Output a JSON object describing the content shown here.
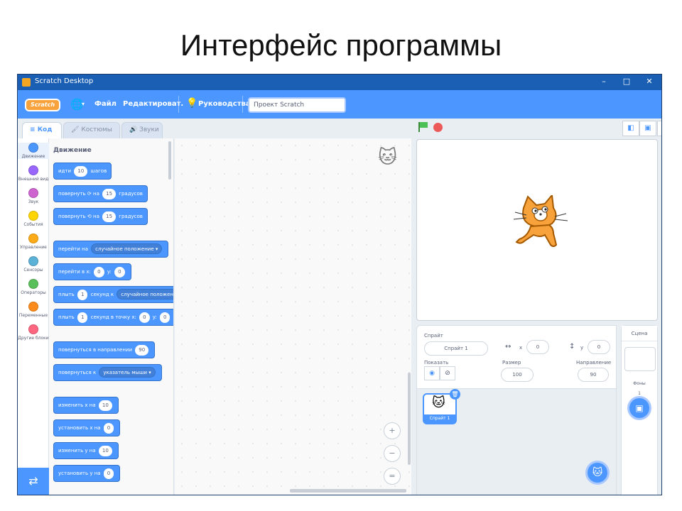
{
  "slide": {
    "title": "Интерфейс программы"
  },
  "window": {
    "title": "Scratch Desktop",
    "minimize": "–",
    "maximize": "□",
    "close": "✕"
  },
  "menubar": {
    "logo": "Scratch",
    "file": "Файл",
    "edit": "Редактироват.",
    "tutorials": "Руководства",
    "project_title": "Проект Scratch"
  },
  "tabs": {
    "code": "Код",
    "costumes": "Костюмы",
    "sounds": "Звуки"
  },
  "categories": [
    {
      "label": "Движение",
      "color": "#4c97ff"
    },
    {
      "label": "Внешний вид",
      "color": "#9966ff"
    },
    {
      "label": "Звук",
      "color": "#cf63cf"
    },
    {
      "label": "События",
      "color": "#ffd500"
    },
    {
      "label": "Управление",
      "color": "#ffab19"
    },
    {
      "label": "Сенсоры",
      "color": "#5cb1d6"
    },
    {
      "label": "Операторы",
      "color": "#59c059"
    },
    {
      "label": "Переменные",
      "color": "#ff8c1a"
    },
    {
      "label": "Другие блоки",
      "color": "#ff6680"
    }
  ],
  "palette": {
    "heading": "Движение",
    "move": {
      "a": "идти",
      "n": "10",
      "b": "шагов"
    },
    "turn_right": {
      "a": "повернуть",
      "b": "на",
      "n": "15",
      "c": "градусов"
    },
    "turn_left": {
      "a": "повернуть",
      "b": "на",
      "n": "15",
      "c": "градусов"
    },
    "goto": {
      "a": "перейти на",
      "dd": "случайное положение"
    },
    "goto_xy": {
      "a": "перейти в x:",
      "x": "0",
      "b": "y:",
      "y": "0"
    },
    "glide": {
      "a": "плыть",
      "n": "1",
      "b": "секунд к",
      "dd": "случайное положение"
    },
    "glide_xy": {
      "a": "плыть",
      "n": "1",
      "b": "секунд в точку x:",
      "x": "0",
      "c": "y:",
      "y": "0"
    },
    "point_dir": {
      "a": "повернуться в направлении",
      "n": "90"
    },
    "point_towards": {
      "a": "повернуться к",
      "dd": "указатель мыши"
    },
    "change_x": {
      "a": "изменить x на",
      "n": "10"
    },
    "set_x": {
      "a": "установить x на",
      "n": "0"
    },
    "change_y": {
      "a": "изменить y на",
      "n": "10"
    },
    "set_y": {
      "a": "установить y на",
      "n": "0"
    }
  },
  "sprite_info": {
    "sprite_label": "Спрайт",
    "sprite_name": "Спрайт 1",
    "x_label": "x",
    "x_value": "0",
    "y_label": "y",
    "y_value": "0",
    "show_label": "Показать",
    "size_label": "Размер",
    "size_value": "100",
    "direction_label": "Направление",
    "direction_value": "90"
  },
  "sprite_list": {
    "thumb_name": "Спрайт 1"
  },
  "stage_pane": {
    "title": "Сцена",
    "backdrops_label": "Фоны",
    "backdrops_count": "1"
  },
  "icons": {
    "globe": "🌐",
    "caret": "▾",
    "bulb": "💡",
    "code_tab": "≡",
    "brush": "🖌",
    "speaker": "🔊",
    "zoom_in": "+",
    "zoom_out": "−",
    "zoom_reset": "=",
    "extension": "⇄",
    "view_small": "◧",
    "view_normal": "▣",
    "fullscreen": "⤢",
    "delete": "🗑",
    "show": "◉",
    "hide": "⊘",
    "horizontal_arrows": "↔",
    "vertical_arrows": "↕",
    "sprite_cat": "🐱",
    "choose_sprite": "🐱",
    "choose_backdrop": "▣"
  },
  "colors": {
    "accent": "#4c97ff",
    "motion_block": "#4c97ff",
    "titlebar": "#1a5fb4",
    "flag": "#4cbf56",
    "stop": "#ec5959"
  }
}
